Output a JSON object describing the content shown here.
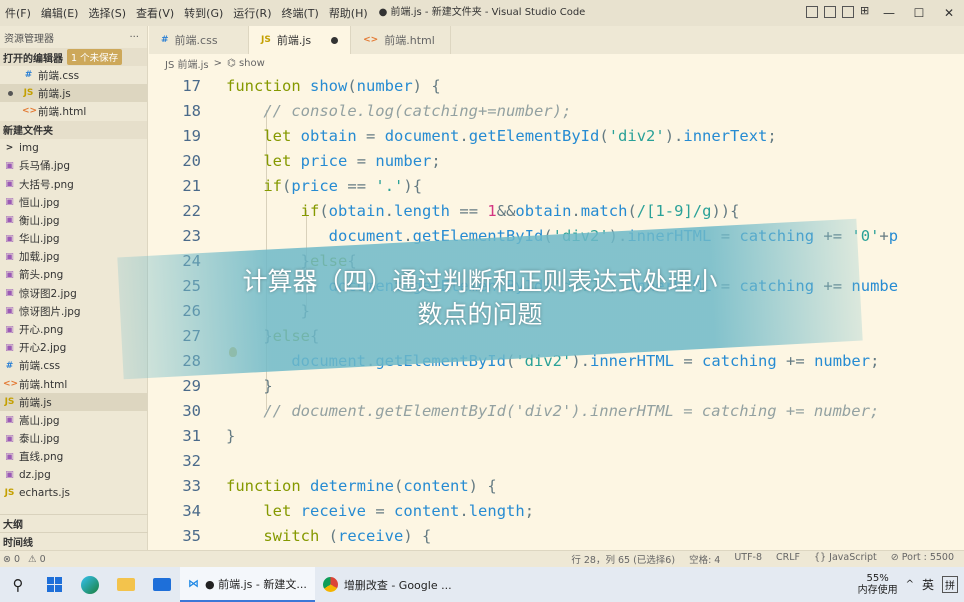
{
  "titlebar": {
    "menus": [
      "件(F)",
      "编辑(E)",
      "选择(S)",
      "查看(V)",
      "转到(G)",
      "运行(R)",
      "终端(T)",
      "帮助(H)"
    ],
    "window_title": "● 前端.js - 新建文件夹 - Visual Studio Code"
  },
  "sidebar": {
    "header": "资源管理器",
    "more": "···",
    "open_editors": {
      "label": "打开的编辑器",
      "badge": "1 个未保存",
      "items": [
        {
          "icon": "#",
          "name": "前端.css",
          "kind": "css"
        },
        {
          "icon": "JS",
          "name": "前端.js",
          "kind": "js"
        },
        {
          "icon": "<>",
          "name": "前端.html",
          "kind": "html"
        }
      ]
    },
    "folder": "新建文件夹",
    "files": [
      {
        "icon": ">",
        "name": "img",
        "kind": "folder"
      },
      {
        "icon": "▣",
        "name": "兵马俑.jpg",
        "kind": "img"
      },
      {
        "icon": "▣",
        "name": "大括号.png",
        "kind": "img"
      },
      {
        "icon": "▣",
        "name": "恒山.jpg",
        "kind": "img"
      },
      {
        "icon": "▣",
        "name": "衡山.jpg",
        "kind": "img"
      },
      {
        "icon": "▣",
        "name": "华山.jpg",
        "kind": "img"
      },
      {
        "icon": "▣",
        "name": "加载.jpg",
        "kind": "img"
      },
      {
        "icon": "▣",
        "name": "箭头.png",
        "kind": "img"
      },
      {
        "icon": "▣",
        "name": "惊讶图2.jpg",
        "kind": "img"
      },
      {
        "icon": "▣",
        "name": "惊讶图片.jpg",
        "kind": "img"
      },
      {
        "icon": "▣",
        "name": "开心.png",
        "kind": "img"
      },
      {
        "icon": "▣",
        "name": "开心2.jpg",
        "kind": "img"
      },
      {
        "icon": "#",
        "name": "前端.css",
        "kind": "css"
      },
      {
        "icon": "<>",
        "name": "前端.html",
        "kind": "html"
      },
      {
        "icon": "JS",
        "name": "前端.js",
        "kind": "js"
      },
      {
        "icon": "▣",
        "name": "嵩山.jpg",
        "kind": "img"
      },
      {
        "icon": "▣",
        "name": "泰山.jpg",
        "kind": "img"
      },
      {
        "icon": "▣",
        "name": "直线.png",
        "kind": "img"
      },
      {
        "icon": "▣",
        "name": "dz.jpg",
        "kind": "img"
      },
      {
        "icon": "JS",
        "name": "echarts.js",
        "kind": "js"
      }
    ],
    "outline": "大纲",
    "timeline": "时间线"
  },
  "tabs": [
    {
      "icon": "#",
      "label": "前端.css",
      "kind": "css"
    },
    {
      "icon": "JS",
      "label": "前端.js",
      "kind": "js"
    },
    {
      "icon": "<>",
      "label": "前端.html",
      "kind": "html"
    }
  ],
  "breadcrumb": {
    "file": "JS 前端.js",
    "sep": ">",
    "symbol": "⌬ show"
  },
  "code_lines": [
    {
      "n": "17",
      "text": "function show(number) {"
    },
    {
      "n": "18",
      "text": "    // console.log(catching+=number);"
    },
    {
      "n": "19",
      "text": "    let obtain = document.getElementById('div2').innerText;"
    },
    {
      "n": "20",
      "text": "    let price = number;"
    },
    {
      "n": "21",
      "text": "    if(price == '.'){"
    },
    {
      "n": "22",
      "text": "        if(obtain.length == 1&&obtain.match(/[1-9]/g)){"
    },
    {
      "n": "23",
      "text": "           document.getElementById('div2').innerHTML = catching += '0'+p"
    },
    {
      "n": "24",
      "text": "        }else{"
    },
    {
      "n": "25",
      "text": "           document.getElementById('div2').innerHTML = catching += numbe"
    },
    {
      "n": "26",
      "text": "        }"
    },
    {
      "n": "27",
      "text": "    }else{"
    },
    {
      "n": "28",
      "text": "       document.getElementById('div2').innerHTML = catching += number;"
    },
    {
      "n": "29",
      "text": "    }"
    },
    {
      "n": "30",
      "text": "    // document.getElementById('div2').innerHTML = catching += number;"
    },
    {
      "n": "31",
      "text": "}"
    },
    {
      "n": "32",
      "text": ""
    },
    {
      "n": "33",
      "text": "function determine(content) {"
    },
    {
      "n": "34",
      "text": "    let receive = content.length;"
    },
    {
      "n": "35",
      "text": "    switch (receive) {"
    }
  ],
  "overlay": {
    "line1": "计算器（四）通过判断和正则表达式处理小",
    "line2": "数点的问题"
  },
  "statusbar": {
    "left": [
      "⊗ 0",
      "⚠ 0"
    ],
    "right": [
      "行 28，列 65 (已选择6)",
      "空格: 4",
      "UTF-8",
      "CRLF",
      "{} JavaScript",
      "⊘ Port : 5500"
    ]
  },
  "taskbar": {
    "apps": [
      {
        "label": "● 前端.js - 新建文...",
        "active": true
      },
      {
        "label": "增删改查 - Google ...",
        "active": false
      }
    ],
    "tray": {
      "mem_pct": "55%",
      "mem_label": "内存使用",
      "ime": "英",
      "ime2": "拼"
    }
  },
  "colors": {
    "keyword": "#268bd2",
    "comment": "#93a1a1",
    "string": "#2aa198",
    "number": "#d33682",
    "plain": "#657b83",
    "selection": "#e8e1c8"
  }
}
